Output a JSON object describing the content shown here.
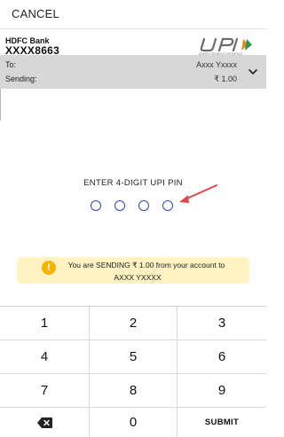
{
  "header": {
    "cancel_label": "CANCEL"
  },
  "account": {
    "bank_name": "HDFC Bank",
    "number": "XXXX8663"
  },
  "logo": {
    "name": "upi-logo",
    "text": "UPI",
    "tagline": "UNIFIED PAYMENTS INTERFACE"
  },
  "details": {
    "to_label": "To:",
    "to_value": "Axxx Yxxxx",
    "sending_label": "Sending:",
    "sending_value": "₹ 1.00",
    "expand_icon": "chevron-down-icon"
  },
  "pin": {
    "title": "ENTER 4-DIGIT UPI PIN",
    "digits": 4
  },
  "banner": {
    "icon": "warning-icon",
    "line1": "You are SENDING ₹ 1.00 from your account to",
    "line2": "AXXX YXXXX"
  },
  "keypad": {
    "keys": [
      "1",
      "2",
      "3",
      "4",
      "5",
      "6",
      "7",
      "8",
      "9",
      "",
      "0",
      ""
    ],
    "backspace_icon": "backspace-icon",
    "submit_label": "SUBMIT"
  },
  "colors": {
    "pin_dot": "#2d4ba0",
    "details_bg": "#d7d7d7",
    "banner_bg": "#fff3c4",
    "warning": "#f4b400",
    "arrow": "#e0474c"
  }
}
